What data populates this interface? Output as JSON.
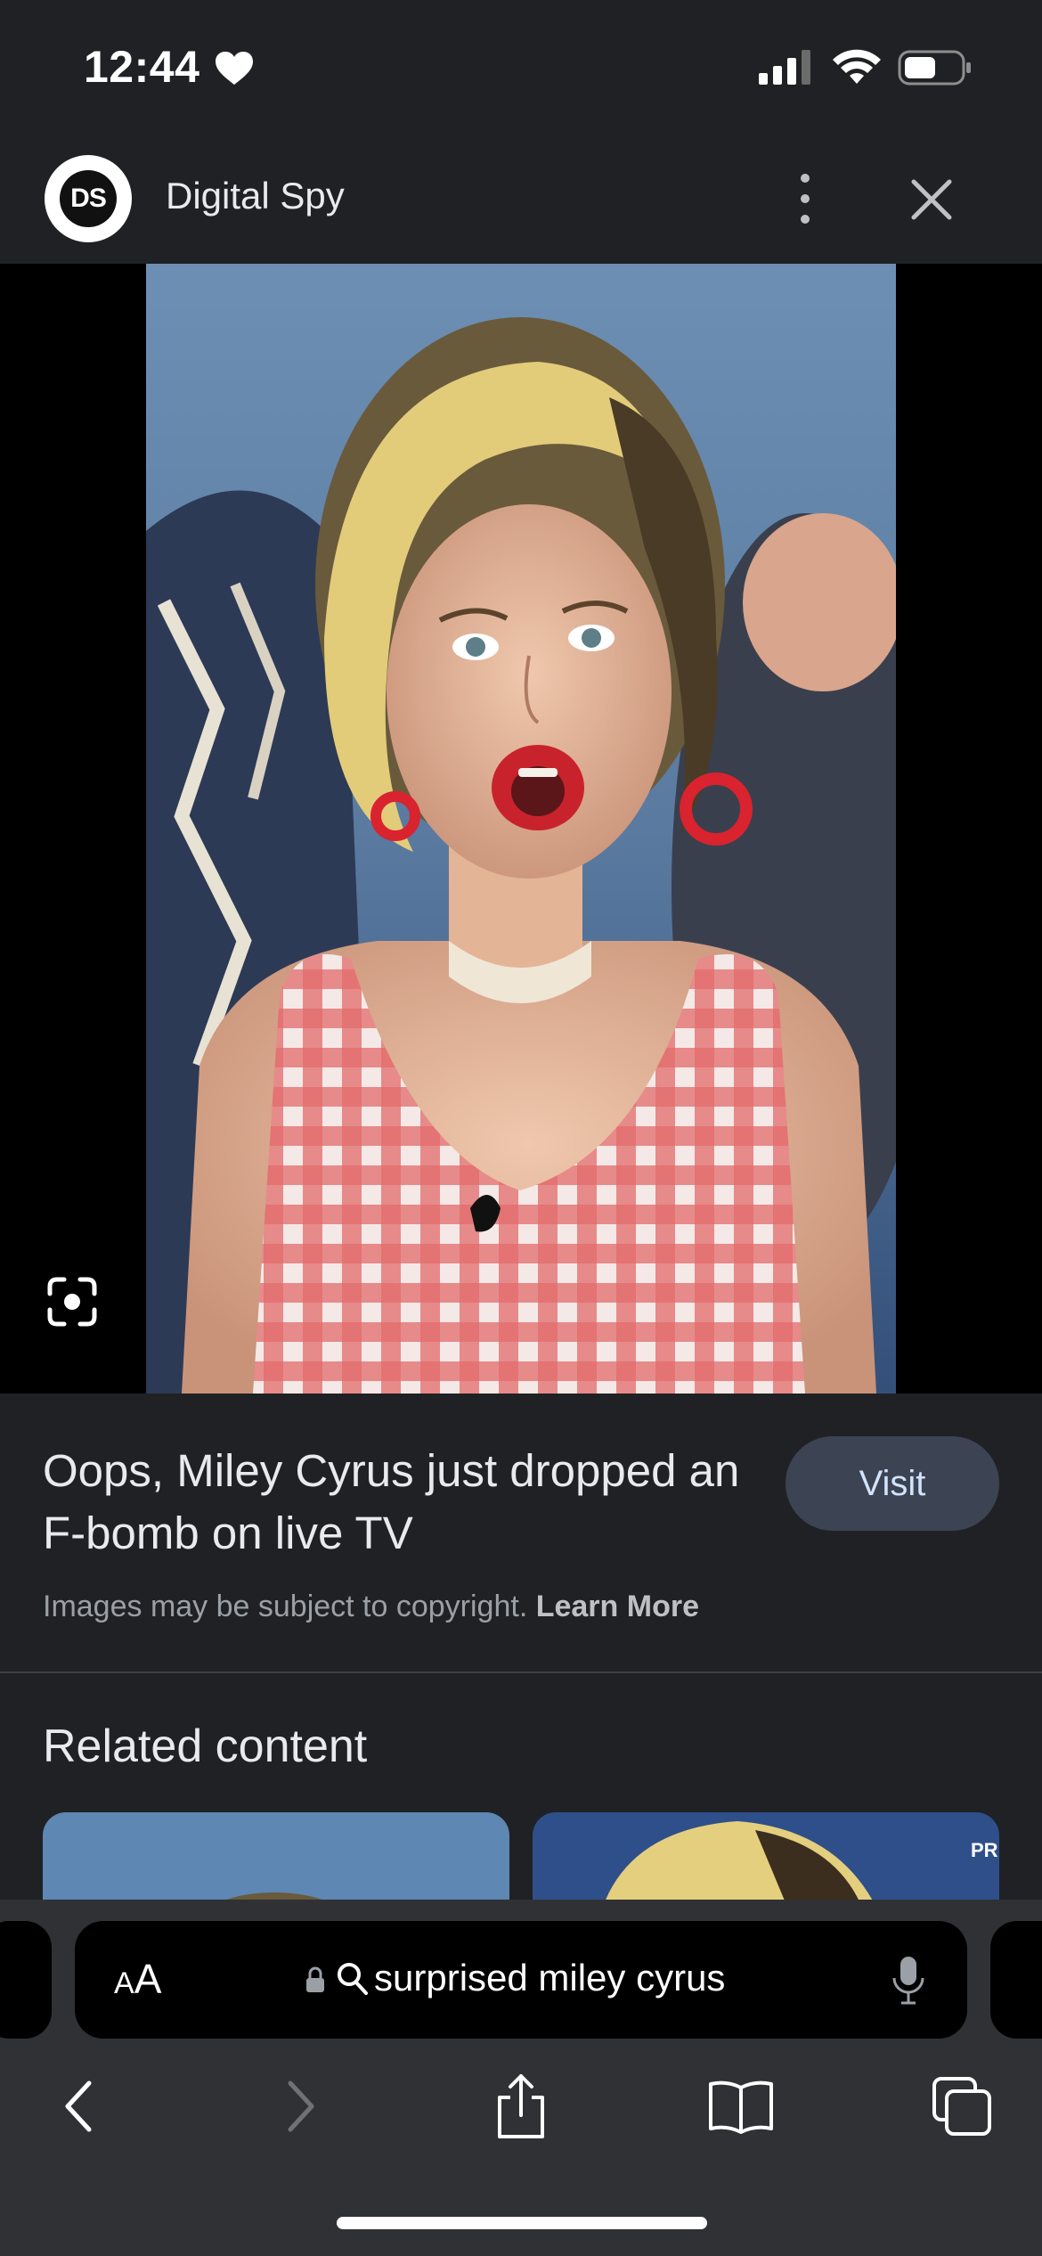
{
  "status_bar": {
    "time": "12:44",
    "icons": [
      "heart-icon",
      "cellular-signal-icon",
      "wifi-icon",
      "battery-icon"
    ]
  },
  "header": {
    "logo_text": "DS",
    "site_name": "Digital Spy",
    "icons": [
      "more-vertical-icon",
      "close-icon"
    ]
  },
  "image": {
    "icons": [
      "lens-icon"
    ]
  },
  "result": {
    "title": "Oops, Miley Cyrus just dropped an F-bomb on live TV",
    "visit_label": "Visit",
    "copyright_text": "Images may be subject to copyright.",
    "learn_more": "Learn More"
  },
  "related": {
    "title": "Related content",
    "thumbnail_badge": "PR BK"
  },
  "browser": {
    "text_size_label_small": "A",
    "text_size_label_large": "A",
    "query": "surprised miley cyrus",
    "icons": [
      "lock-icon",
      "search-icon",
      "microphone-icon",
      "back-icon",
      "forward-icon",
      "share-icon",
      "bookmarks-icon",
      "tabs-icon"
    ]
  }
}
